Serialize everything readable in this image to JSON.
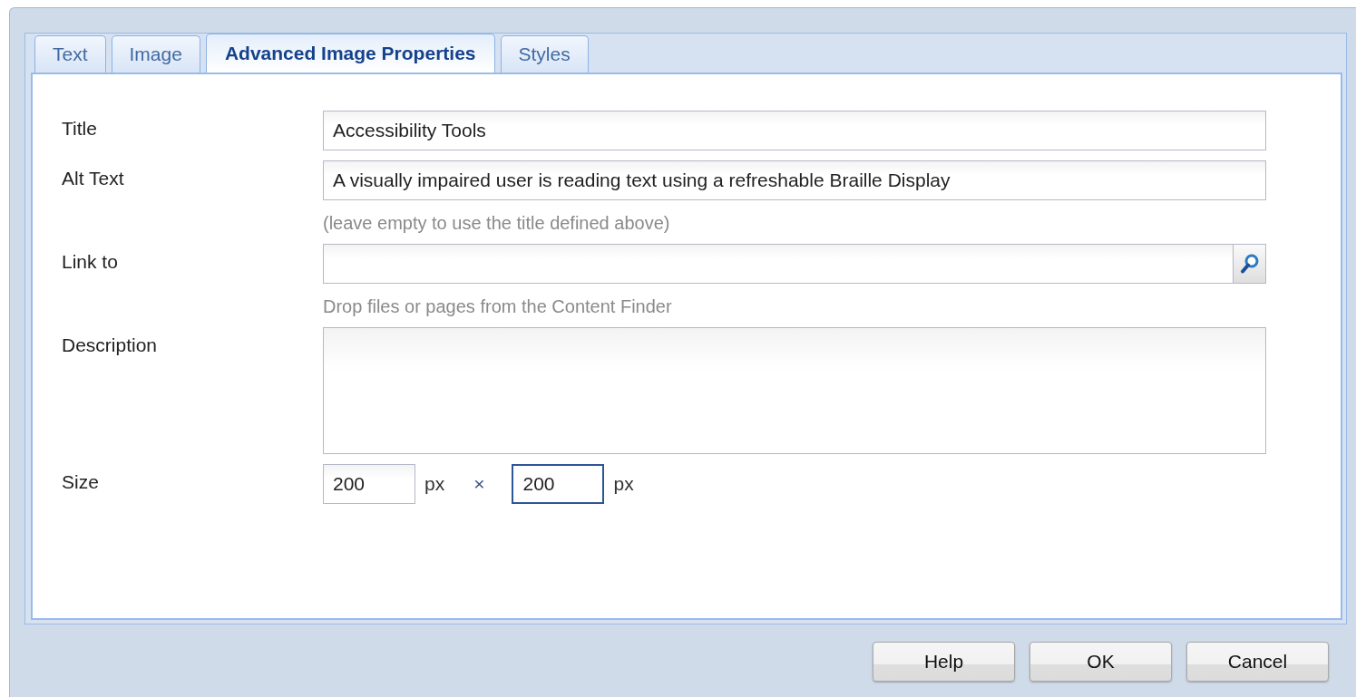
{
  "tabs": [
    {
      "label": "Text",
      "selected": false
    },
    {
      "label": "Image",
      "selected": false
    },
    {
      "label": "Advanced Image Properties",
      "selected": true
    },
    {
      "label": "Styles",
      "selected": false
    }
  ],
  "fields": [
    {
      "kind": "text",
      "label": "Title",
      "value": "Accessibility Tools"
    },
    {
      "kind": "text",
      "label": "Alt Text",
      "value": "A visually impaired user is reading text using a refreshable Braille Display",
      "hint": "(leave empty to use the title defined above)"
    },
    {
      "kind": "browse",
      "label": "Link to",
      "hint": "Drop files or pages from the Content Finder"
    },
    {
      "kind": "textarea",
      "label": "Description"
    },
    {
      "kind": "size",
      "label": "Size",
      "width": {
        "value": "200",
        "unit": "px",
        "focused": false
      },
      "separator": "×",
      "height": {
        "value": "200",
        "unit": "px",
        "focused": true
      }
    }
  ],
  "buttons": [
    "Help",
    "OK",
    "Cancel"
  ]
}
